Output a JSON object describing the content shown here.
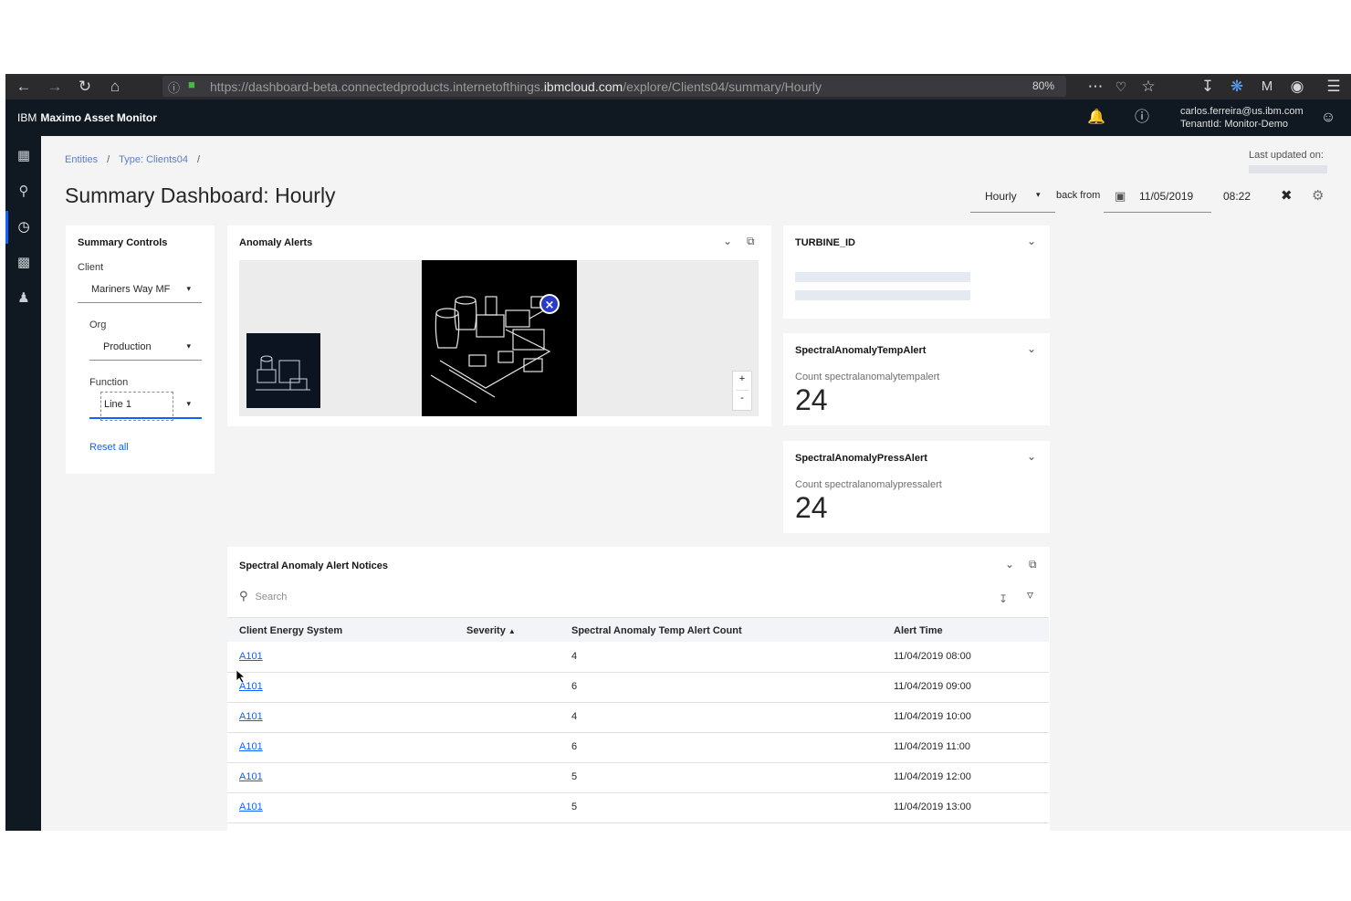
{
  "browser": {
    "url_prefix": "https://dashboard-beta.connectedproducts.internetofthings.",
    "url_domain": "ibmcloud.com",
    "url_suffix": "/explore/Clients04/summary/Hourly",
    "zoom": "80%"
  },
  "header": {
    "brand_prefix": "IBM",
    "brand_name": "Maximo Asset Monitor",
    "user_email": "carlos.ferreira@us.ibm.com",
    "tenant": "TenantId: Monitor-Demo"
  },
  "breadcrumb": {
    "entities": "Entities",
    "type": "Type: Clients04"
  },
  "page": {
    "title": "Summary Dashboard: Hourly",
    "last_updated_label": "Last updated on:"
  },
  "controls": {
    "interval": "Hourly",
    "back_from_label": "back from",
    "date": "11/05/2019",
    "time": "08:22"
  },
  "summary_controls": {
    "title": "Summary Controls",
    "client_label": "Client",
    "client_value": "Mariners Way MF",
    "org_label": "Org",
    "org_value": "Production",
    "function_label": "Function",
    "function_value": "Line 1",
    "reset_label": "Reset all"
  },
  "anomaly_alerts": {
    "title": "Anomaly Alerts",
    "zoom_in": "+",
    "zoom_out": "-"
  },
  "turbine": {
    "title": "TURBINE_ID"
  },
  "temp_alert": {
    "title": "SpectralAnomalyTempAlert",
    "label": "Count spectralanomalytempalert",
    "value": "24"
  },
  "press_alert": {
    "title": "SpectralAnomalyPressAlert",
    "label": "Count spectralanomalypressalert",
    "value": "24"
  },
  "notices": {
    "title": "Spectral Anomaly Alert Notices",
    "search_placeholder": "Search",
    "columns": {
      "client": "Client Energy System",
      "severity": "Severity",
      "count": "Spectral Anomaly Temp Alert Count",
      "time": "Alert Time"
    },
    "rows": [
      {
        "client": "A101",
        "count": "4",
        "time": "11/04/2019 08:00"
      },
      {
        "client": "A101",
        "count": "6",
        "time": "11/04/2019 09:00"
      },
      {
        "client": "A101",
        "count": "4",
        "time": "11/04/2019 10:00"
      },
      {
        "client": "A101",
        "count": "6",
        "time": "11/04/2019 11:00"
      },
      {
        "client": "A101",
        "count": "5",
        "time": "11/04/2019 12:00"
      },
      {
        "client": "A101",
        "count": "5",
        "time": "11/04/2019 13:00"
      }
    ]
  },
  "colors": {
    "header_bg": "#101821",
    "link": "#0f62fe",
    "page_bg": "#f4f4f4"
  },
  "icons": [
    "back-arrow-icon",
    "forward-arrow-icon",
    "reload-icon",
    "home-icon",
    "info-icon",
    "lock-icon",
    "more-icon",
    "pocket-icon",
    "star-icon",
    "download-icon",
    "extension-icon",
    "account-icon",
    "menu-icon",
    "notification-icon",
    "help-icon",
    "user-avatar-icon",
    "dashboard-icon",
    "connections-icon",
    "compass-icon",
    "devices-icon",
    "users-icon",
    "calendar-icon",
    "pin-icon",
    "settings-icon",
    "chevron-down-icon",
    "popout-icon",
    "search-icon",
    "filter-icon",
    "sort-ascending-icon",
    "close-circle-icon"
  ]
}
